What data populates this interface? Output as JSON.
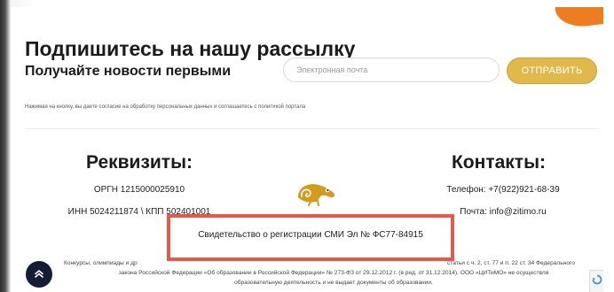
{
  "subscribe": {
    "title": "Подпишитесь на нашу рассылку",
    "subtitle": "Получайте новости первыми",
    "email_placeholder": "Электронная почта",
    "submit_label": "ОТПРАВИТЬ",
    "consent": "Нажимая на кнопку, вы даете согласие на обработку персональных данных и соглашаетесь с политикой портала"
  },
  "requisites": {
    "title": "Реквизиты:",
    "ogrn": "ОРГН 1215000025910",
    "inn": "ИНН 5024211874 \\ КПП 502401001"
  },
  "contacts": {
    "title": "Контакты:",
    "phone": "Телефон: +7(922)921-68-39",
    "email": "Почта: info@zitimo.ru"
  },
  "certificate": "Свидетельство о регистрации СМИ Эл № ФС77-84915",
  "footer": {
    "line1_left": "Конкурсы, олимпиады и др",
    "line1_right": "статьи с ч. 2, ст. 77 и п. 22 ст. 34 Федерального",
    "line2": "закона Российской Федерации «Об образовании в Российской Федерации» № 273-ФЗ от 29.12.2012 г. (в ред. от 31.12.2014). ООО «ЦИТиМО» не осуществля",
    "line3": "образовательную деятельность и не выдает документы об образовании."
  },
  "icons": {
    "scroll_top": "double-chevron-up-icon",
    "logo": "chameleon-logo",
    "recaptcha": "recaptcha-icon"
  },
  "colors": {
    "accent_button": "#e1b94a",
    "highlight_border": "#e25a48",
    "logo": "#d29a1f",
    "scroll_button": "#141d33",
    "corner_accent": "#ee7d22"
  }
}
